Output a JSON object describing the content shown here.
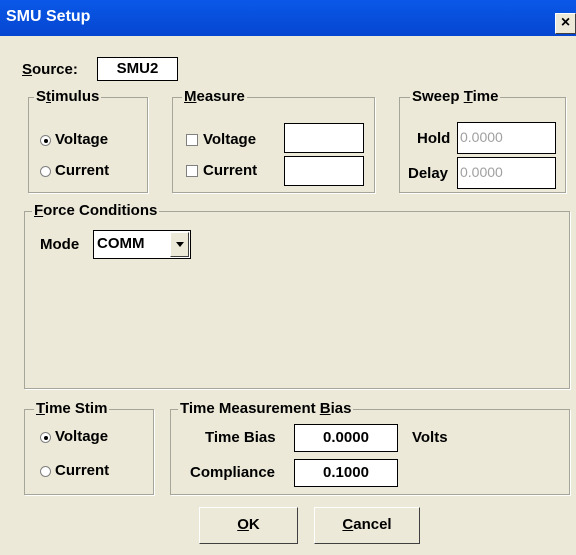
{
  "window": {
    "title": "SMU Setup",
    "close_glyph": "×"
  },
  "source": {
    "label_prefix": "",
    "label_mnemonic": "S",
    "label_rest": "ource:",
    "value": "SMU2"
  },
  "stimulus": {
    "title_a": "S",
    "title_m": "t",
    "title_b": "imulus",
    "options": [
      {
        "label": "Voltage",
        "selected": true
      },
      {
        "label": "Current",
        "selected": false
      }
    ]
  },
  "measure": {
    "title_m": "M",
    "title_b": "easure",
    "options": [
      {
        "label": "Voltage",
        "checked": false,
        "value": ""
      },
      {
        "label": "Current",
        "checked": false,
        "value": ""
      }
    ]
  },
  "sweep_time": {
    "title_a": "Sweep ",
    "title_m": "T",
    "title_b": "ime",
    "hold_label": "Hold",
    "hold_value": "0.0000",
    "delay_label": "Delay",
    "delay_value": "0.0000"
  },
  "force_conditions": {
    "title_m": "F",
    "title_b": "orce Conditions",
    "mode_label": "Mode",
    "mode_value": "COMM"
  },
  "time_stim": {
    "title_m": "T",
    "title_b": "ime Stim",
    "options": [
      {
        "label": "Voltage",
        "selected": true
      },
      {
        "label": "Current",
        "selected": false
      }
    ]
  },
  "time_bias": {
    "title_a": "Time Measurement ",
    "title_m": "B",
    "title_b": "ias",
    "bias_label": "Time Bias",
    "bias_value": "0.0000",
    "bias_unit": "Volts",
    "compliance_label": "Compliance",
    "compliance_value": "0.1000"
  },
  "buttons": {
    "ok_m": "O",
    "ok_b": "K",
    "cancel_m": "C",
    "cancel_b": "ancel"
  }
}
